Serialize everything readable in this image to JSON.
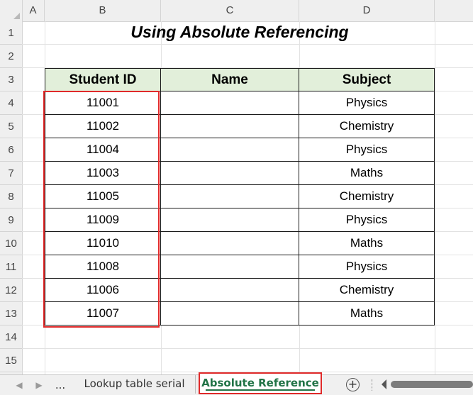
{
  "columns": [
    "A",
    "B",
    "C",
    "D"
  ],
  "rows": [
    "1",
    "2",
    "3",
    "4",
    "5",
    "6",
    "7",
    "8",
    "9",
    "10",
    "11",
    "12",
    "13",
    "14",
    "15"
  ],
  "title": "Using Absolute Referencing",
  "table": {
    "headers": [
      "Student ID",
      "Name",
      "Subject"
    ],
    "rows": [
      [
        "11001",
        "",
        "Physics"
      ],
      [
        "11002",
        "",
        "Chemistry"
      ],
      [
        "11004",
        "",
        "Physics"
      ],
      [
        "11003",
        "",
        "Maths"
      ],
      [
        "11005",
        "",
        "Chemistry"
      ],
      [
        "11009",
        "",
        "Physics"
      ],
      [
        "11010",
        "",
        "Maths"
      ],
      [
        "11008",
        "",
        "Physics"
      ],
      [
        "11006",
        "",
        "Chemistry"
      ],
      [
        "11007",
        "",
        "Maths"
      ]
    ]
  },
  "tabs": {
    "ellipsis": "...",
    "items": [
      {
        "label": "Lookup table serial",
        "active": false
      },
      {
        "label": "Absolute Reference",
        "active": true
      }
    ],
    "add_symbol": "+"
  },
  "colors": {
    "header_fill": "#e2efda",
    "highlight_border": "#e02a2a",
    "active_tab_text": "#217346"
  }
}
